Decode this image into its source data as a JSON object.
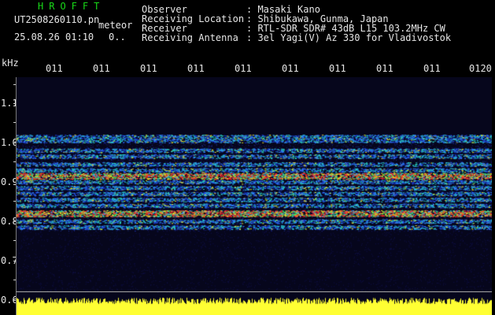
{
  "header": {
    "software": "HROFFT",
    "filename": "UT2508260110.pn",
    "tag": "meteor",
    "datetime": "25.08.26 01:10",
    "extra": "0..",
    "info_labels": [
      "Observer",
      "Receiving Location",
      "Receiver",
      "Receiving Antenna"
    ],
    "info_values": [
      ": Masaki Kano",
      ": Shibukawa, Gunma, Japan",
      ": RTL-SDR SDR# 43dB L15 103.2MHz CW",
      ": 3el Yagi(V) Az 330 for Vladivostok"
    ]
  },
  "y_axis": {
    "unit": "kHz",
    "labels": [
      "1.1",
      "1.0",
      "0.9",
      "0.8",
      "0.7",
      "0.6"
    ]
  },
  "time_axis": {
    "labels": [
      "011",
      "011",
      "011",
      "011",
      "011",
      "011",
      "011",
      "011",
      "011",
      "0120"
    ]
  },
  "colors": {
    "text": "#e6e6e6",
    "title_green": "#18d818",
    "marker_yellow": "#ffff33",
    "background": "#000000",
    "noise": "#0a0a2a"
  },
  "spectrogram": {
    "bands_khz": [
      1.015,
      1.005,
      0.98,
      0.965,
      0.945,
      0.93,
      0.915,
      0.9,
      0.885,
      0.87,
      0.855,
      0.84,
      0.82,
      0.8,
      0.785
    ],
    "strong_bands_khz": [
      0.915,
      0.82
    ],
    "strong_band_color": "#ff2a2a"
  }
}
